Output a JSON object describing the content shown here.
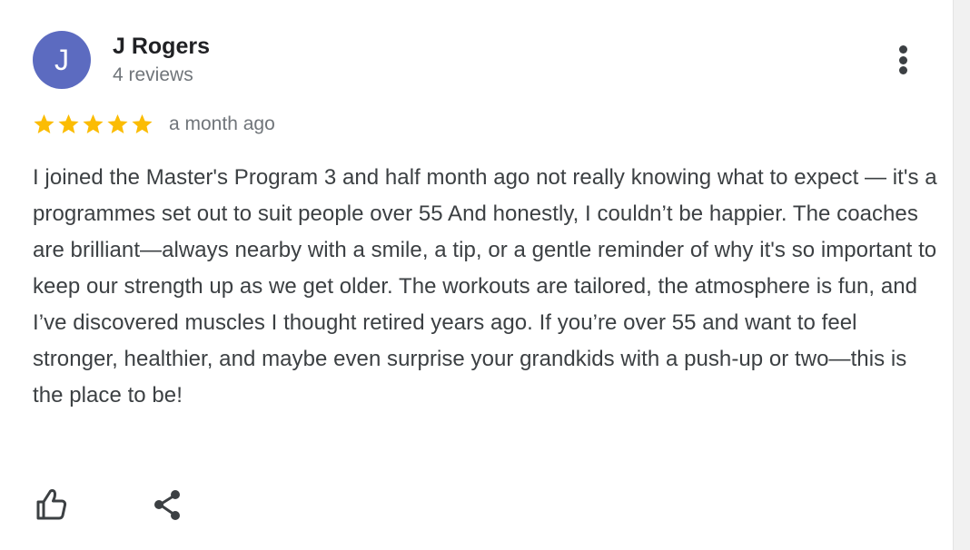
{
  "reviewer": {
    "initial": "J",
    "name": "J Rogers",
    "review_count": "4 reviews",
    "avatar_color": "#5c6bc0"
  },
  "review": {
    "rating": 5,
    "rating_max": 5,
    "date": "a month ago",
    "text": "I joined the Master's Program 3 and half month ago not really knowing what to expect — it's a programmes set out to suit people over 55 And honestly, I couldn’t be happier. The coaches are brilliant—always nearby with a smile, a tip, or a gentle reminder of why it's so important to keep our strength up as we get older. The workouts are tailored, the atmosphere is fun, and I’ve discovered muscles I thought retired years ago. If you’re over 55 and want to feel stronger, healthier, and maybe even surprise your grandkids with a push-up or two—this is the place to be!"
  },
  "icons": {
    "more": "more-vert-icon",
    "star": "star-icon",
    "like": "thumbs-up-icon",
    "share": "share-icon"
  },
  "colors": {
    "star": "#fbbc04",
    "text": "#3c4043",
    "secondary_text": "#70757a",
    "name_text": "#202124"
  }
}
